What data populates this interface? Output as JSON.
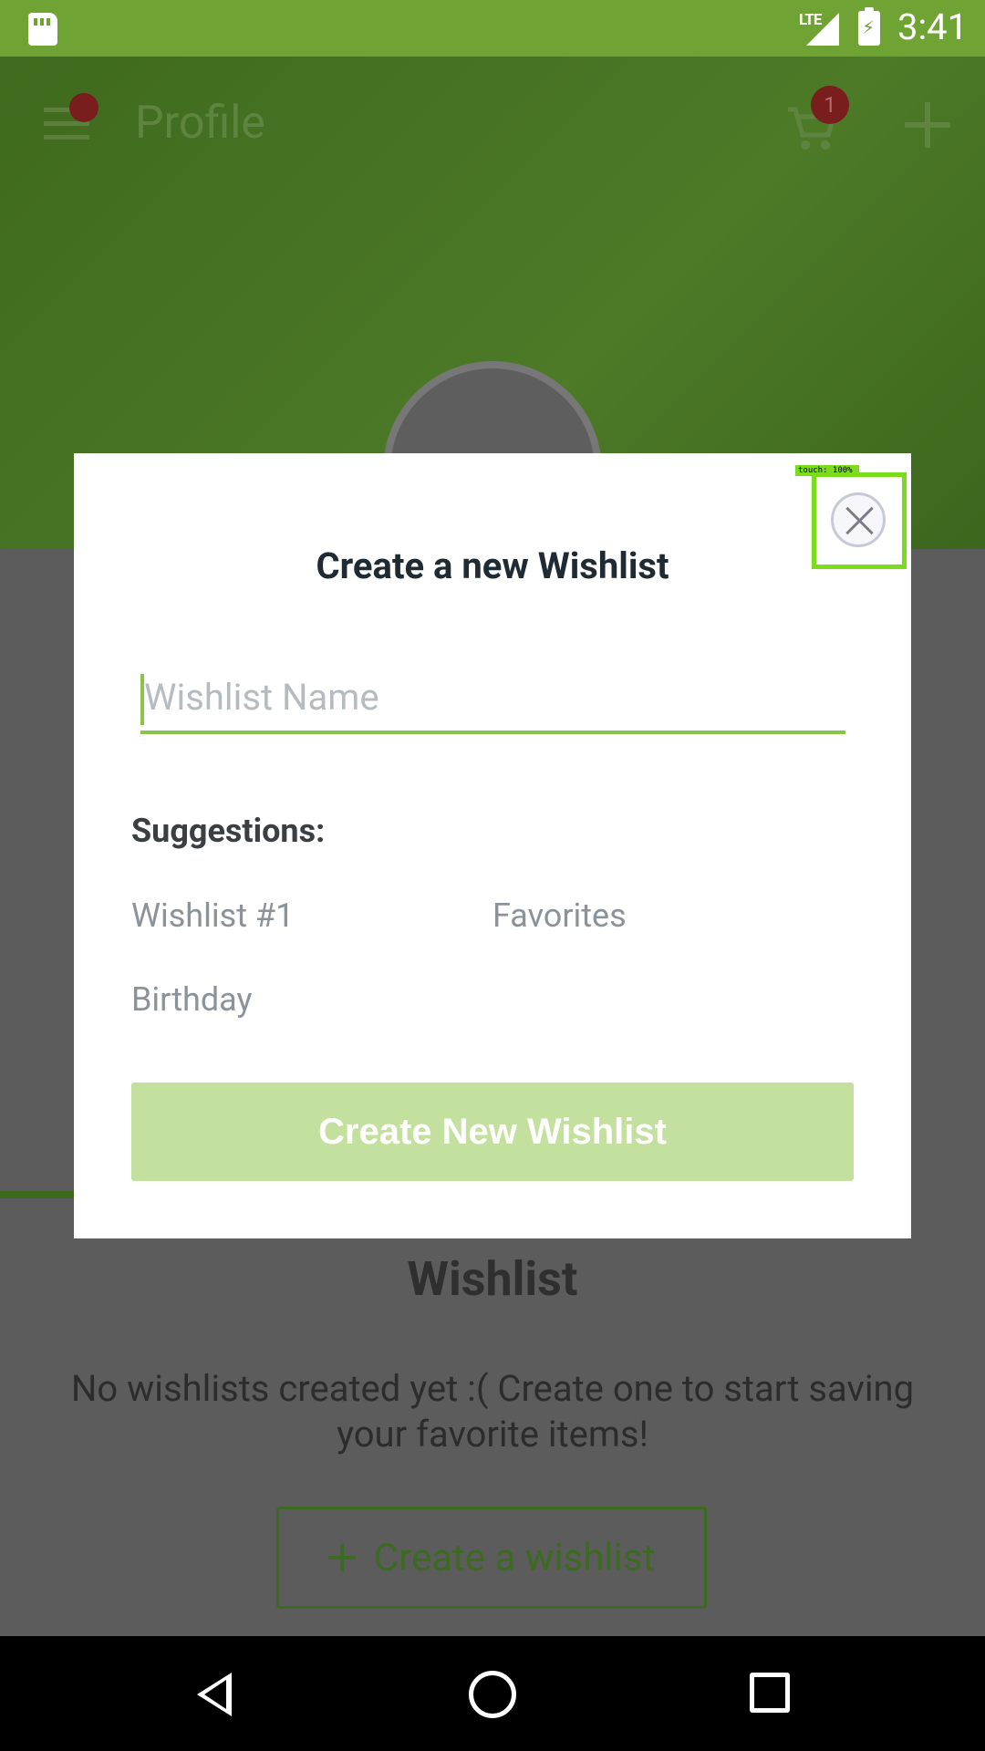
{
  "status_bar": {
    "network": "LTE",
    "time": "3:41"
  },
  "header": {
    "title": "Profile",
    "cart_count": "1"
  },
  "wishlist_section": {
    "title": "Wishlist",
    "empty_message": "No wishlists created yet :( Create one to start saving your favorite items!",
    "create_button_label": "Create a wishlist"
  },
  "dialog": {
    "title": "Create a new Wishlist",
    "input_placeholder": "Wishlist Name",
    "input_value": "",
    "suggestions_label": "Suggestions:",
    "suggestions": [
      "Wishlist #1",
      "Favorites",
      "Birthday"
    ],
    "submit_label": "Create New Wishlist",
    "touch_label": "touch: 100%"
  },
  "colors": {
    "accent": "#8cc34a",
    "status_bar": "#6fa334",
    "submit_disabled": "#c3e09e",
    "highlight": "#7bdc1e"
  },
  "icons": [
    "sd-card-icon",
    "signal-icon",
    "battery-icon",
    "menu-icon",
    "cart-icon",
    "add-icon",
    "close-icon",
    "plus-icon",
    "back-icon",
    "home-icon",
    "recents-icon"
  ]
}
